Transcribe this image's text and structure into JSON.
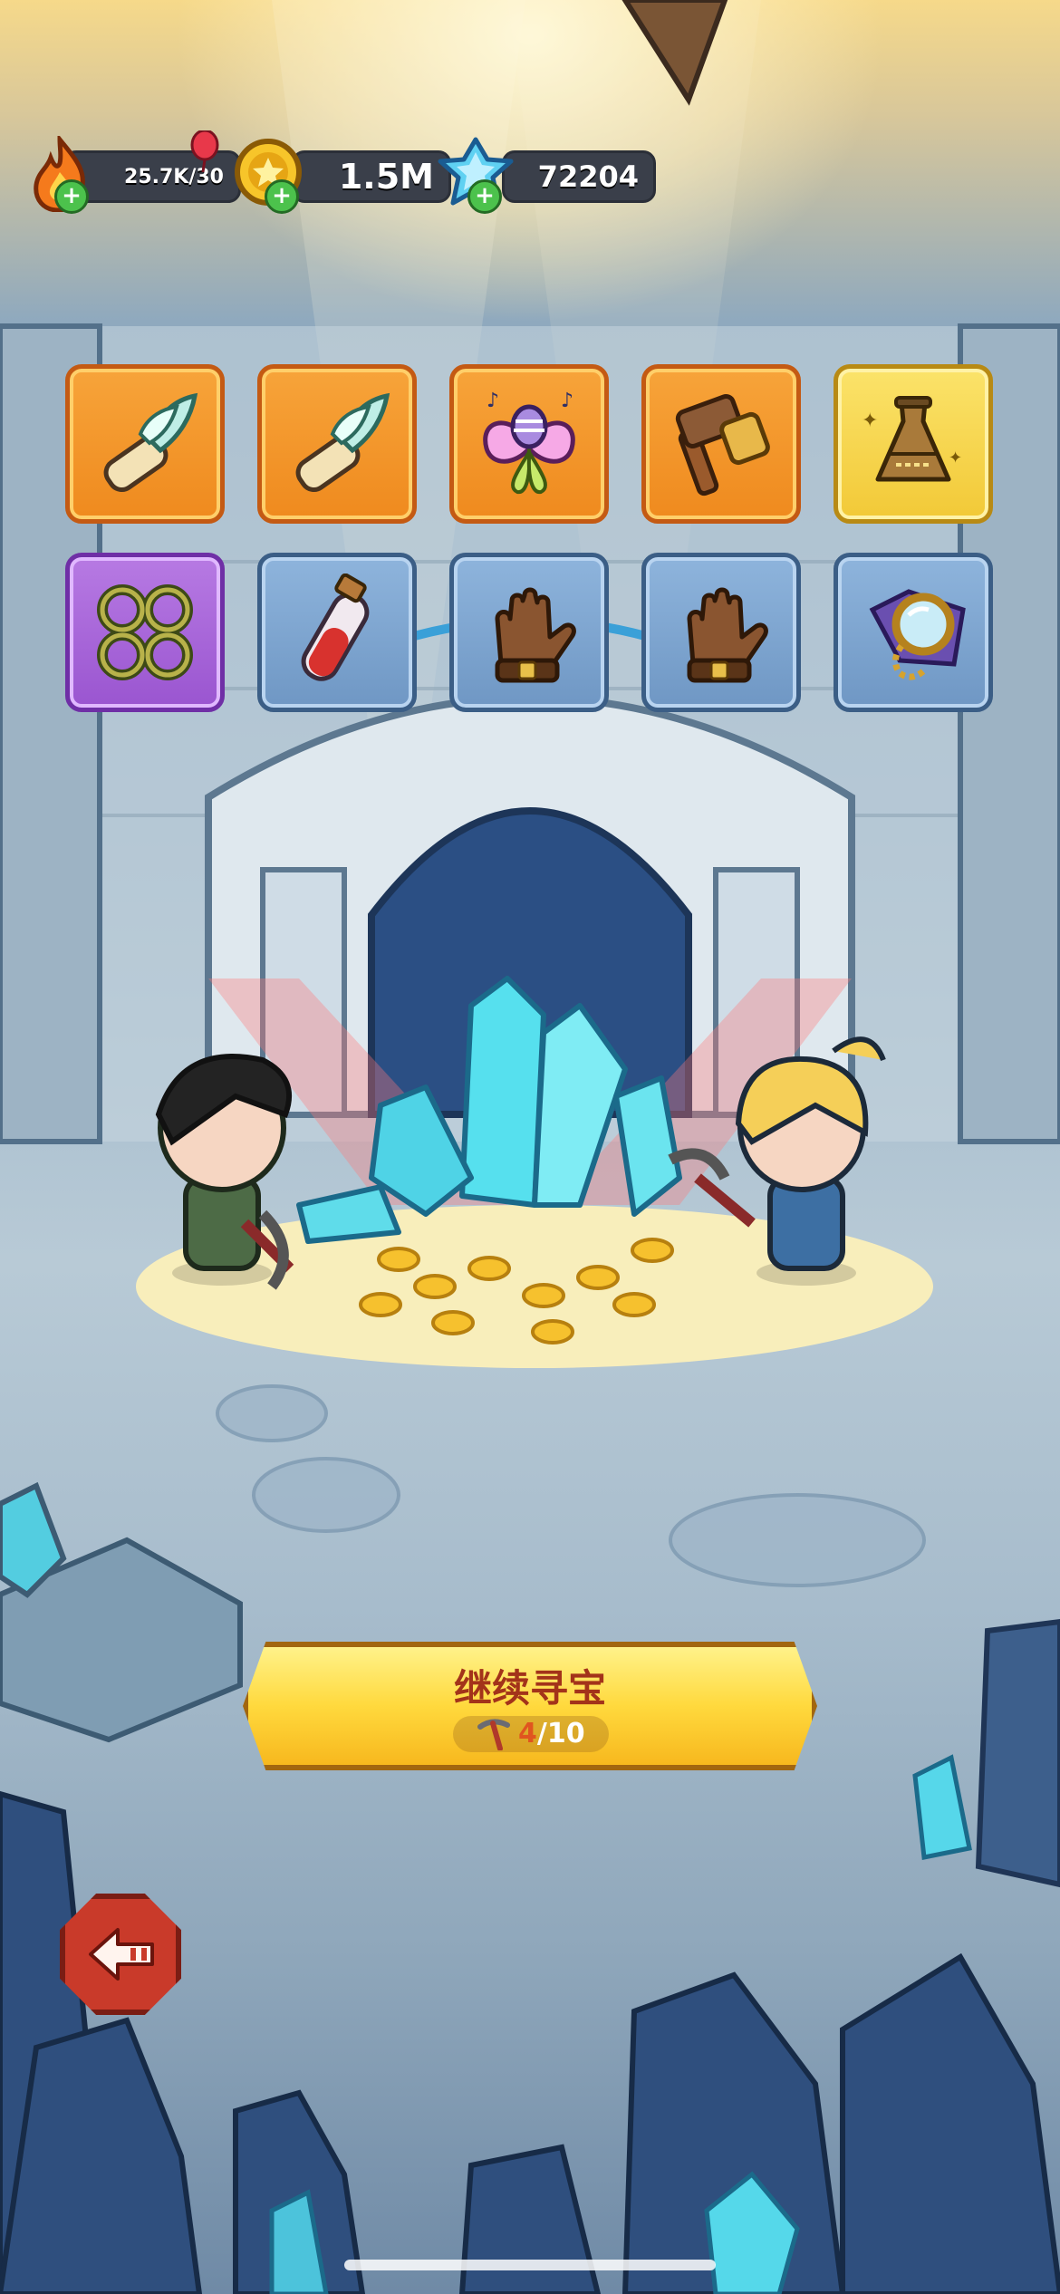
{
  "hud": {
    "energy": {
      "value": "25.7K/30",
      "icon": "flame-icon",
      "add": "+"
    },
    "coins": {
      "value": "1.5M",
      "icon": "coin-icon",
      "add": "+"
    },
    "gems": {
      "value": "72204",
      "icon": "crystal-icon",
      "add": "+"
    }
  },
  "items": [
    {
      "icon": "feather-scroll-icon",
      "rarity": "orange"
    },
    {
      "icon": "feather-scroll-icon",
      "rarity": "orange"
    },
    {
      "icon": "music-butterfly-icon",
      "rarity": "orange"
    },
    {
      "icon": "hammer-icon",
      "rarity": "orange"
    },
    {
      "icon": "sand-timer-vase-icon",
      "rarity": "gold"
    },
    {
      "icon": "thorn-chain-icon",
      "rarity": "purple"
    },
    {
      "icon": "potion-vial-icon",
      "rarity": "blue"
    },
    {
      "icon": "leather-glove-icon",
      "rarity": "blue"
    },
    {
      "icon": "leather-glove-icon",
      "rarity": "blue"
    },
    {
      "icon": "magnifier-amulet-icon",
      "rarity": "blue"
    }
  ],
  "continue_button": {
    "label": "继续寻宝",
    "count_current": "4",
    "count_total": "/10",
    "icon": "pickaxe-icon"
  },
  "back_button": {
    "icon": "back-arrow-icon"
  },
  "colors": {
    "button_text": "#a3331a",
    "count_current": "#e0551f",
    "count_total": "#ffffff"
  }
}
